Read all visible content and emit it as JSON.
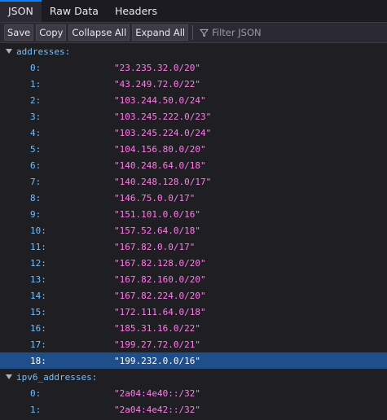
{
  "tabs": [
    {
      "label": "JSON",
      "active": true
    },
    {
      "label": "Raw Data",
      "active": false
    },
    {
      "label": "Headers",
      "active": false
    }
  ],
  "toolbar": {
    "save": "Save",
    "copy": "Copy",
    "collapse_all": "Collapse All",
    "expand_all": "Expand All",
    "filter_icon": "funnel-icon",
    "filter_placeholder": "Filter JSON",
    "filter_value": ""
  },
  "colors": {
    "accent": "#0a84ff",
    "key": "#75bfff",
    "string": "#ff7de9",
    "selection": "#204e8a"
  },
  "tree": {
    "addresses": {
      "key": "addresses:",
      "expanded": true,
      "items": [
        {
          "index": "0:",
          "value": "\"23.235.32.0/20\""
        },
        {
          "index": "1:",
          "value": "\"43.249.72.0/22\""
        },
        {
          "index": "2:",
          "value": "\"103.244.50.0/24\""
        },
        {
          "index": "3:",
          "value": "\"103.245.222.0/23\""
        },
        {
          "index": "4:",
          "value": "\"103.245.224.0/24\""
        },
        {
          "index": "5:",
          "value": "\"104.156.80.0/20\""
        },
        {
          "index": "6:",
          "value": "\"140.248.64.0/18\""
        },
        {
          "index": "7:",
          "value": "\"140.248.128.0/17\""
        },
        {
          "index": "8:",
          "value": "\"146.75.0.0/17\""
        },
        {
          "index": "9:",
          "value": "\"151.101.0.0/16\""
        },
        {
          "index": "10:",
          "value": "\"157.52.64.0/18\""
        },
        {
          "index": "11:",
          "value": "\"167.82.0.0/17\""
        },
        {
          "index": "12:",
          "value": "\"167.82.128.0/20\""
        },
        {
          "index": "13:",
          "value": "\"167.82.160.0/20\""
        },
        {
          "index": "14:",
          "value": "\"167.82.224.0/20\""
        },
        {
          "index": "15:",
          "value": "\"172.111.64.0/18\""
        },
        {
          "index": "16:",
          "value": "\"185.31.16.0/22\""
        },
        {
          "index": "17:",
          "value": "\"199.27.72.0/21\""
        },
        {
          "index": "18:",
          "value": "\"199.232.0.0/16\"",
          "selected": true
        }
      ]
    },
    "ipv6_addresses": {
      "key": "ipv6_addresses:",
      "expanded": true,
      "items": [
        {
          "index": "0:",
          "value": "\"2a04:4e40::/32\""
        },
        {
          "index": "1:",
          "value": "\"2a04:4e42::/32\""
        }
      ]
    }
  }
}
